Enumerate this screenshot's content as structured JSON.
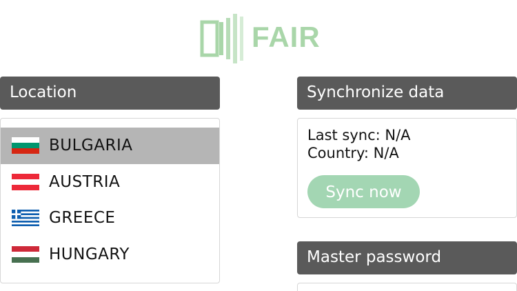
{
  "brand": {
    "name": "FAIR"
  },
  "location": {
    "header": "Location",
    "items": [
      {
        "name": "BULGARIA",
        "flag": "bulgaria-flag",
        "selected": true
      },
      {
        "name": "AUSTRIA",
        "flag": "austria-flag",
        "selected": false
      },
      {
        "name": "GREECE",
        "flag": "greece-flag",
        "selected": false
      },
      {
        "name": "HUNGARY",
        "flag": "hungary-flag",
        "selected": false
      }
    ]
  },
  "sync": {
    "header": "Synchronize data",
    "last_sync": "Last sync: N/A",
    "country": "Country: N/A",
    "button": "Sync now"
  },
  "master_password": {
    "header": "Master password"
  },
  "colors": {
    "header_bg": "#5a5a5a",
    "selected_row": "#b5b5b5",
    "accent_green": "#a3d6b3",
    "logo_green": "#a9d6a9"
  }
}
